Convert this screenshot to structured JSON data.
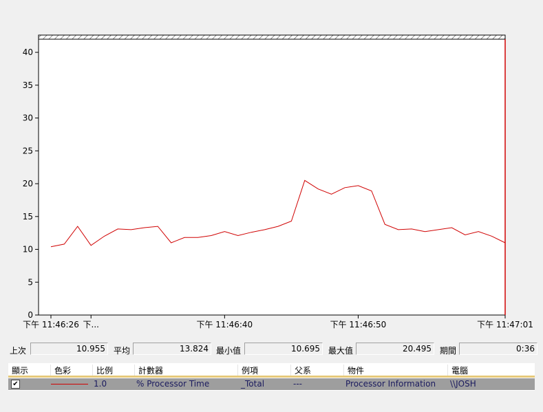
{
  "chart": {
    "y_ticks": [
      "0",
      "5",
      "10",
      "15",
      "20",
      "25",
      "30",
      "35",
      "40"
    ],
    "x_ticks": [
      {
        "label": "下午 11:46:26"
      },
      {
        "label": "下..."
      },
      {
        "label": "下午 11:46:40"
      },
      {
        "label": "下午 11:46:50"
      },
      {
        "label": "下午 11:47:01"
      }
    ]
  },
  "chart_data": {
    "type": "line",
    "ylim": [
      0,
      42
    ],
    "x": [
      0,
      1,
      2,
      3,
      4,
      5,
      6,
      7,
      8,
      9,
      10,
      11,
      12,
      13,
      14,
      15,
      16,
      17,
      18,
      19,
      20,
      21,
      22,
      23,
      24,
      25,
      26,
      27,
      28,
      29,
      30,
      31,
      32,
      33,
      34,
      35
    ],
    "series": [
      {
        "color": "#d00000",
        "values": [
          10.4,
          10.8,
          13.5,
          10.6,
          12.0,
          13.1,
          13.0,
          13.3,
          13.5,
          11.0,
          11.8,
          11.8,
          12.1,
          12.7,
          12.1,
          12.6,
          13.0,
          13.5,
          14.3,
          20.5,
          19.2,
          18.4,
          19.4,
          19.7,
          18.9,
          13.8,
          13.0,
          13.1,
          12.7,
          13.0,
          13.3,
          12.2,
          12.7,
          12.0,
          11.0
        ]
      }
    ],
    "y_tick_values": [
      0,
      5,
      10,
      15,
      20,
      25,
      30,
      35,
      40
    ],
    "cursor_at_end": true
  },
  "stats": {
    "last_label": "上次",
    "last_value": "10.955",
    "avg_label": "平均",
    "avg_value": "13.824",
    "min_label": "最小值",
    "min_value": "10.695",
    "max_label": "最大值",
    "max_value": "20.495",
    "duration_label": "期間",
    "duration_value": "0:36"
  },
  "table": {
    "headers": {
      "show": "顯示",
      "color": "色彩",
      "scale": "比例",
      "counter": "計數器",
      "instance": "例項",
      "parent": "父系",
      "object": "物件",
      "computer": "電腦"
    },
    "row": {
      "checked": "✔",
      "scale": "1.0",
      "counter": "% Processor Time",
      "instance": "_Total",
      "parent": "---",
      "object": "Processor Information",
      "computer": "\\\\JOSH"
    }
  },
  "colors": {
    "series": "#d00000",
    "header_accent": "#e6c97a",
    "row_selected": "#9e9e9e"
  }
}
